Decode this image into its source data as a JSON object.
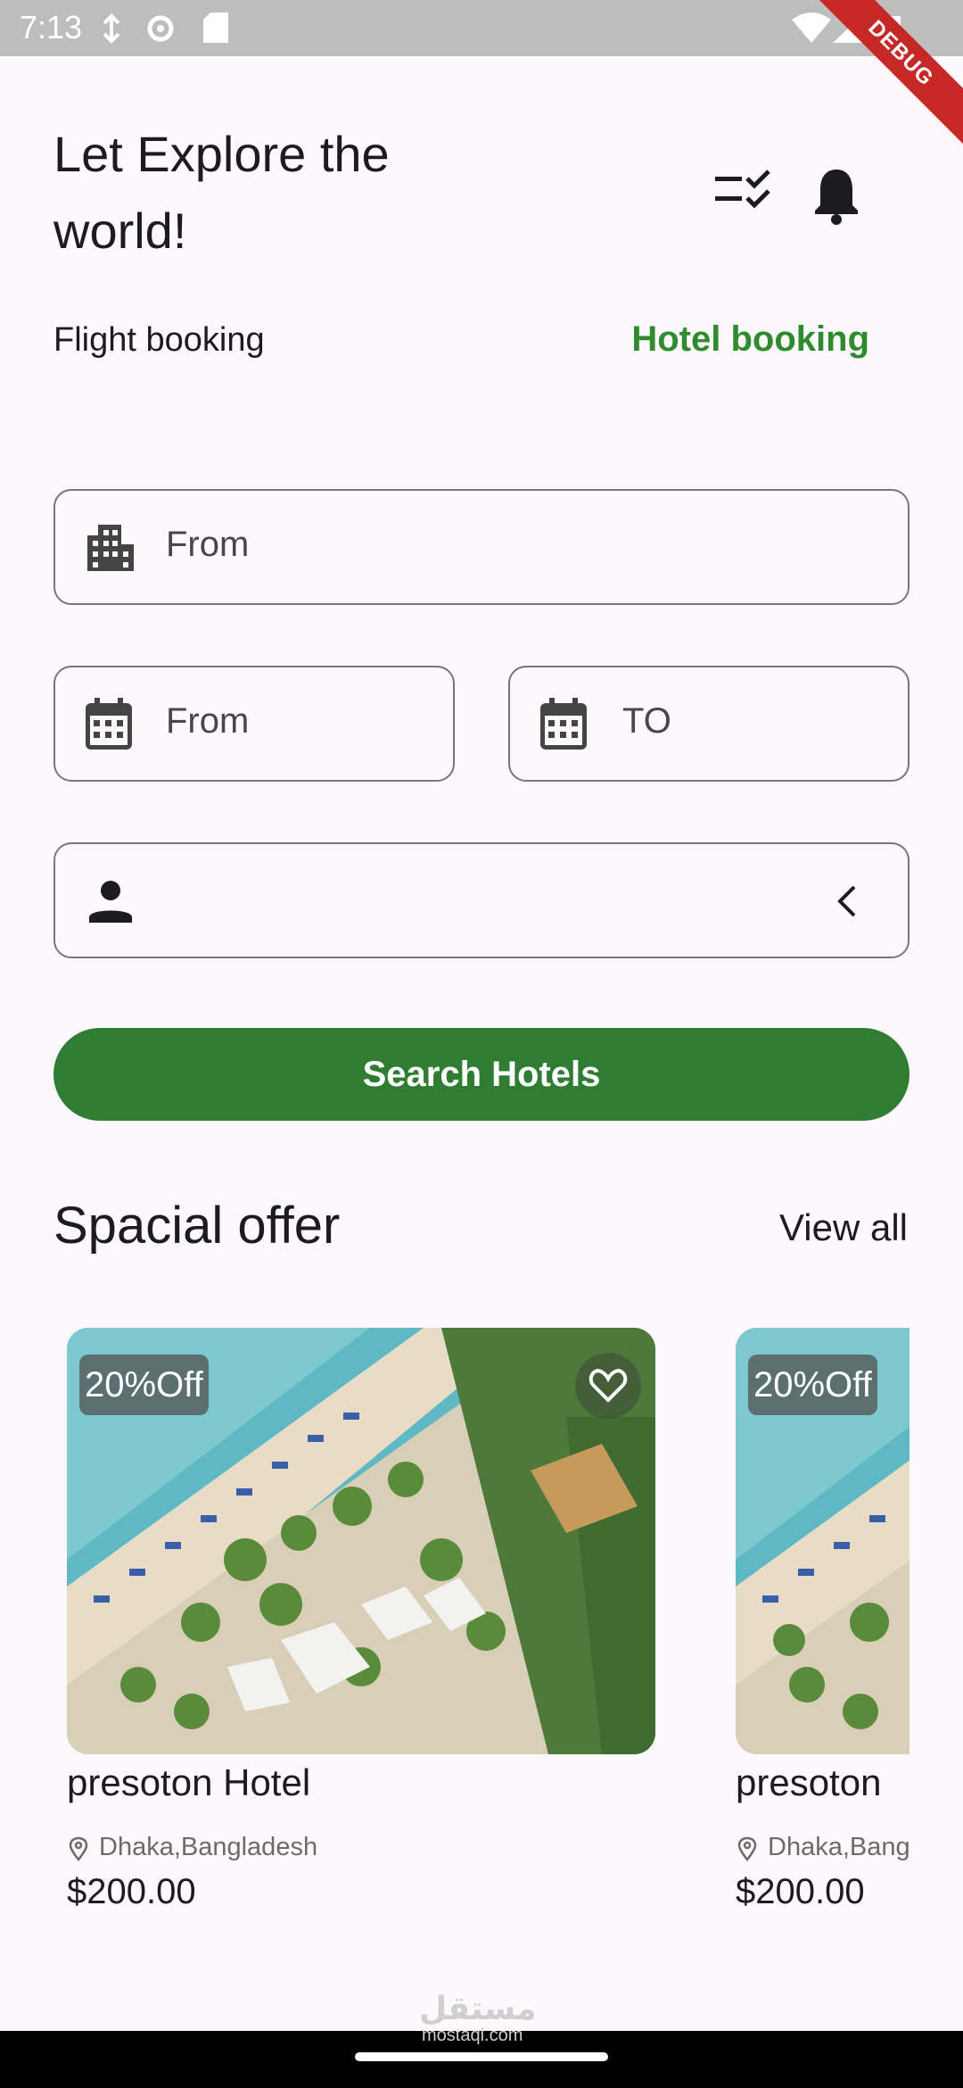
{
  "status_bar": {
    "time": "7:13",
    "debug_label": "DEBUG"
  },
  "header": {
    "title": "Let Explore the world!"
  },
  "tabs": {
    "flight": "Flight booking",
    "hotel": "Hotel booking",
    "active_color": "#2e8b2e"
  },
  "form": {
    "location_placeholder": "From",
    "checkin_placeholder": "From",
    "checkout_placeholder": "TO",
    "guests_value": ""
  },
  "search_button": {
    "label": "Search Hotels",
    "color": "#2e7d32"
  },
  "offers": {
    "title": "Spacial offer",
    "view_all": "View all",
    "cards": [
      {
        "discount": "20%Off",
        "name": "presoton Hotel",
        "location": "Dhaka,Bangladesh",
        "price": "$200.00"
      },
      {
        "discount": "20%Off",
        "name": "presoton",
        "location": "Dhaka,Bang",
        "price": "$200.00"
      }
    ]
  },
  "watermark": {
    "text": "مستقل",
    "sub": "mostaql.com"
  }
}
